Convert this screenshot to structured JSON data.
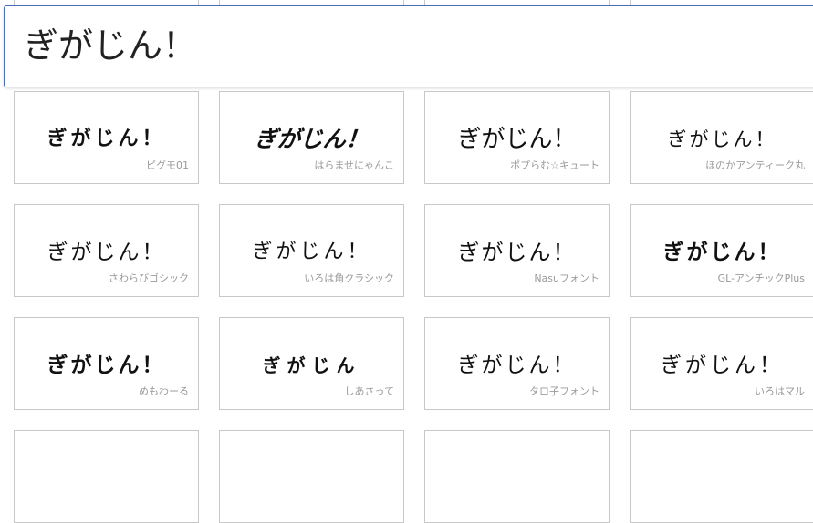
{
  "search": {
    "value": "ぎがじん！"
  },
  "sample_text": "ぎがじん！",
  "fonts": [
    {
      "sample": "ぎがじん！",
      "name": "ピグモ01"
    },
    {
      "sample": "ぎがじん！",
      "name": "はらませにゃんこ"
    },
    {
      "sample": "ぎがじん！",
      "name": "ポプらむ☆キュート"
    },
    {
      "sample": "ぎがじん！",
      "name": "ほのかアンティーク丸"
    },
    {
      "sample": "ぎがじん！",
      "name": "さわらびゴシック"
    },
    {
      "sample": "ぎがじん！",
      "name": "いろは角クラシック"
    },
    {
      "sample": "ぎがじん！",
      "name": "Nasuフォント"
    },
    {
      "sample": "ぎがじん！",
      "name": "GL-アンチックPlus"
    },
    {
      "sample": "ぎがじん！",
      "name": "めもわーる"
    },
    {
      "sample": "ぎがじん",
      "name": "しあさって"
    },
    {
      "sample": "ぎがじん！",
      "name": "タロ子フォント"
    },
    {
      "sample": "ぎがじん！",
      "name": "いろはマル"
    }
  ]
}
